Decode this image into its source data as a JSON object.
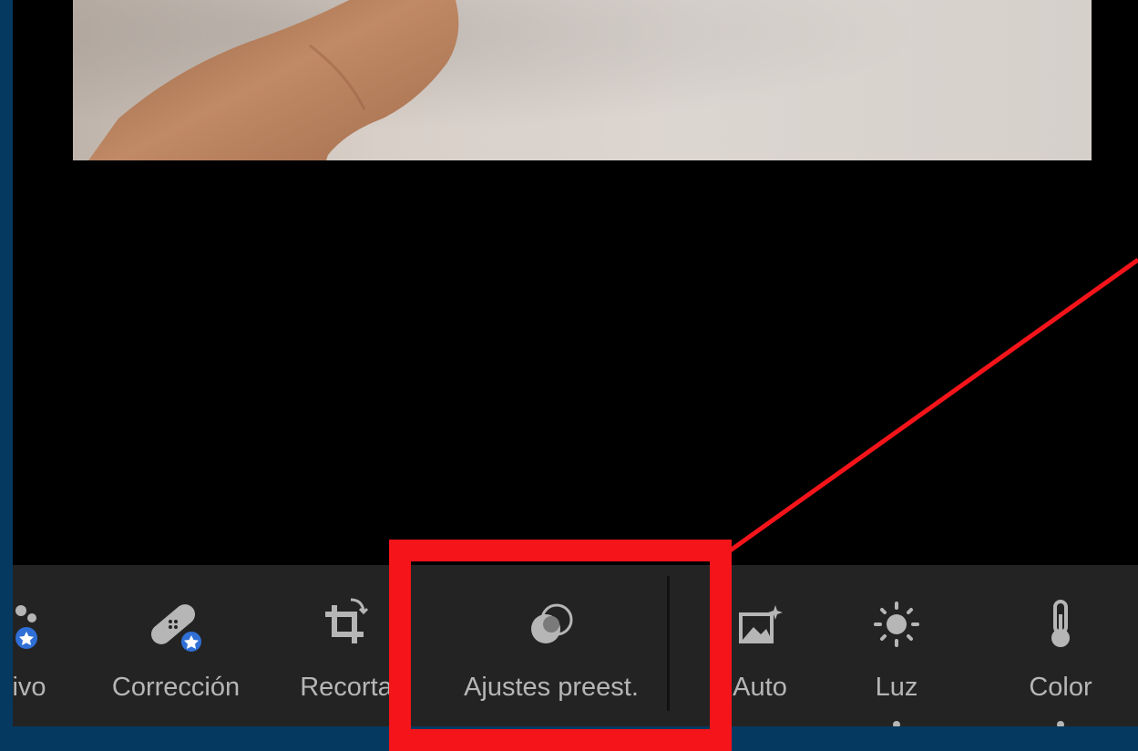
{
  "toolbar": {
    "items": [
      {
        "label": "tivo",
        "icon": "selective-star-icon"
      },
      {
        "label": "Corrección",
        "icon": "bandage-star-icon"
      },
      {
        "label": "Recorta",
        "icon": "crop-rotate-icon"
      },
      {
        "label": "Ajustes preest.",
        "icon": "presets-icon"
      },
      {
        "label": "Auto",
        "icon": "auto-image-icon"
      },
      {
        "label": "Luz",
        "icon": "sun-icon"
      },
      {
        "label": "Color",
        "icon": "thermometer-icon"
      }
    ]
  },
  "colors": {
    "frame": "#05395f",
    "toolbar_bg": "#232323",
    "label_gray": "#b6b6b6",
    "highlight_red": "#f4141a",
    "badge_blue": "#2f6fd6"
  }
}
